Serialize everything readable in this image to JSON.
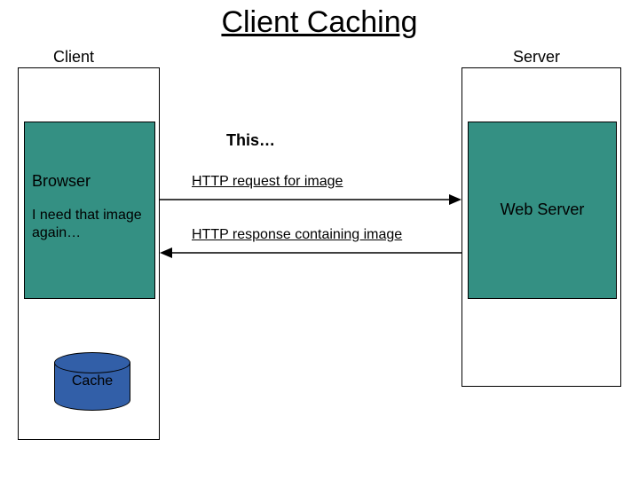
{
  "title": "Client Caching",
  "client": {
    "label": "Client",
    "browser": {
      "label": "Browser",
      "thought": "I need that image again…"
    },
    "cache": {
      "label": "Cache"
    }
  },
  "server": {
    "label": "Server",
    "webserver": {
      "label": "Web Server"
    }
  },
  "center": {
    "this_label": "This…",
    "request_label": "HTTP request for image",
    "response_label": "HTTP response containing image"
  },
  "colors": {
    "box_fill": "#349083",
    "cyl_fill": "#325fa8"
  }
}
